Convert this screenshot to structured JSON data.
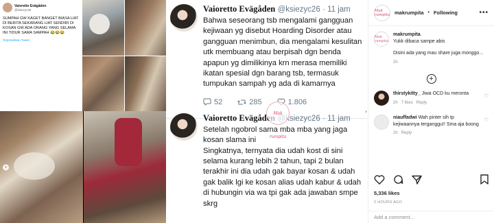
{
  "collage": {
    "tweet_card": {
      "name": "Vaioretto Evägåden",
      "handle": "@ksiezyc26",
      "text": "SUMPAH GW KAGET BANGET BIASA LIAT DI BERITA SEKARANG LIAT SENDIRI DI KOSAN GW ADA ORANG YANG SELAMA INI TIDUR SAMA SAMPAH 😂😂😂",
      "translate": "Terjemahkan Tweet"
    }
  },
  "tweets": [
    {
      "name": "Vaioretto Evägåden",
      "handle": "@ksiezyc26",
      "time": "· 11 jam",
      "text": "Bahwa seseorang tsb mengalami gangguan kejiwaan yg disebut Hoarding Disorder atau gangguan menimbun, dia mengalami kesulitan utk membuang atau berpisah dgn benda apapun yg dimilikinya krn merasa memiliki ikatan spesial dgn barang tsb, termasuk tumpukan sampah yg ada di kamarnya",
      "replies": "52",
      "retweets": "285",
      "likes": "1.806"
    },
    {
      "name": "Vaioretto Evägåden",
      "handle": "@ksiezyc26",
      "time": "· 11 jam",
      "text": "Setelah ngobrol sama mba mba yang jaga kosan slama ini\nSingkatnya, ternyata dia udah kost di sini selama kurang lebih 2 tahun, tapi 2 bulan terakhir ini dia udah gak bayar kosan & udah gak balik lgi ke kosan alias udah kabur & udah di hubungin via wa tpi gak ada jawaban smpe skrg"
    }
  ],
  "watermark": "Mak rumpita",
  "instagram": {
    "account": "makrumpita",
    "separator": "•",
    "follow_label": "Following",
    "more": "•••",
    "caption": {
      "user": "makrumpita",
      "suffix": ".",
      "lines": [
        "Yukk dibaca sampe abis",
        "Disini ada yang mau share juga monggo..."
      ],
      "time": "2h"
    },
    "load_more": "+",
    "comments": [
      {
        "user": "thirstykitty_",
        "text": "Jiwa OCD ku meronta",
        "time": "2h",
        "likes": "7 likes",
        "reply": "Reply"
      },
      {
        "user": "niauffadwi",
        "text": "Wah pinter sih tp kejiwaannya terganggu!! Sma aja boong",
        "time": "2h",
        "reply": "Reply"
      }
    ],
    "likes": "5,336 likes",
    "timestamp": "2 HOURS AGO",
    "add_comment_placeholder": "Add a comment..."
  }
}
